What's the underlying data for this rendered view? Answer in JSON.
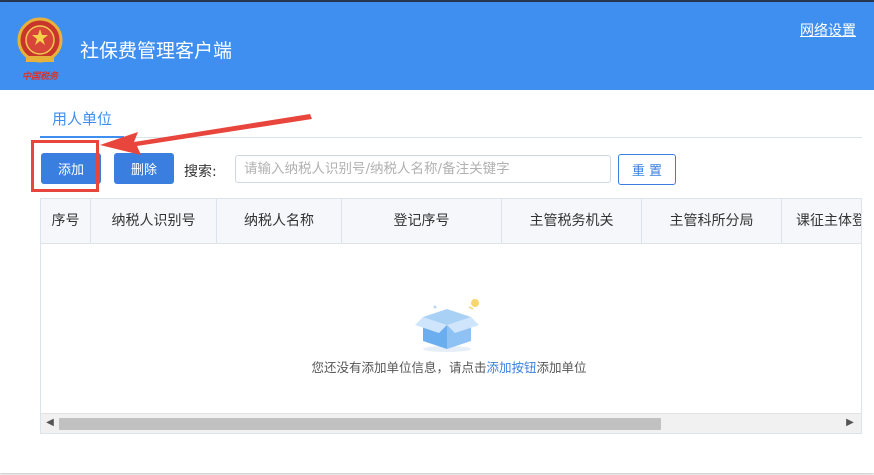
{
  "window": {
    "title": "社保费管理客户端",
    "network_settings": "网络设置",
    "logo_caption": "中国税务"
  },
  "tabs": [
    {
      "label": "用人单位",
      "active": true
    }
  ],
  "toolbar": {
    "add_label": "添加",
    "delete_label": "删除",
    "search_label": "搜索:",
    "search_placeholder": "请输入纳税人识别号/纳税人名称/备注关键字",
    "search_value": "",
    "reset_label": "重 置"
  },
  "table": {
    "columns": [
      "序号",
      "纳税人识别号",
      "纳税人名称",
      "登记序号",
      "主管税务机关",
      "主管科所分局",
      "课征主体登"
    ],
    "rows": []
  },
  "empty_state": {
    "text_before": "您还没有添加单位信息，请点击",
    "link": "添加按钮",
    "text_after": "添加单位",
    "icon": "empty-box-icon"
  },
  "colors": {
    "titlebar": "#3f8ff0",
    "primary_button": "#3a7fe0",
    "annotation": "#e8453c"
  }
}
